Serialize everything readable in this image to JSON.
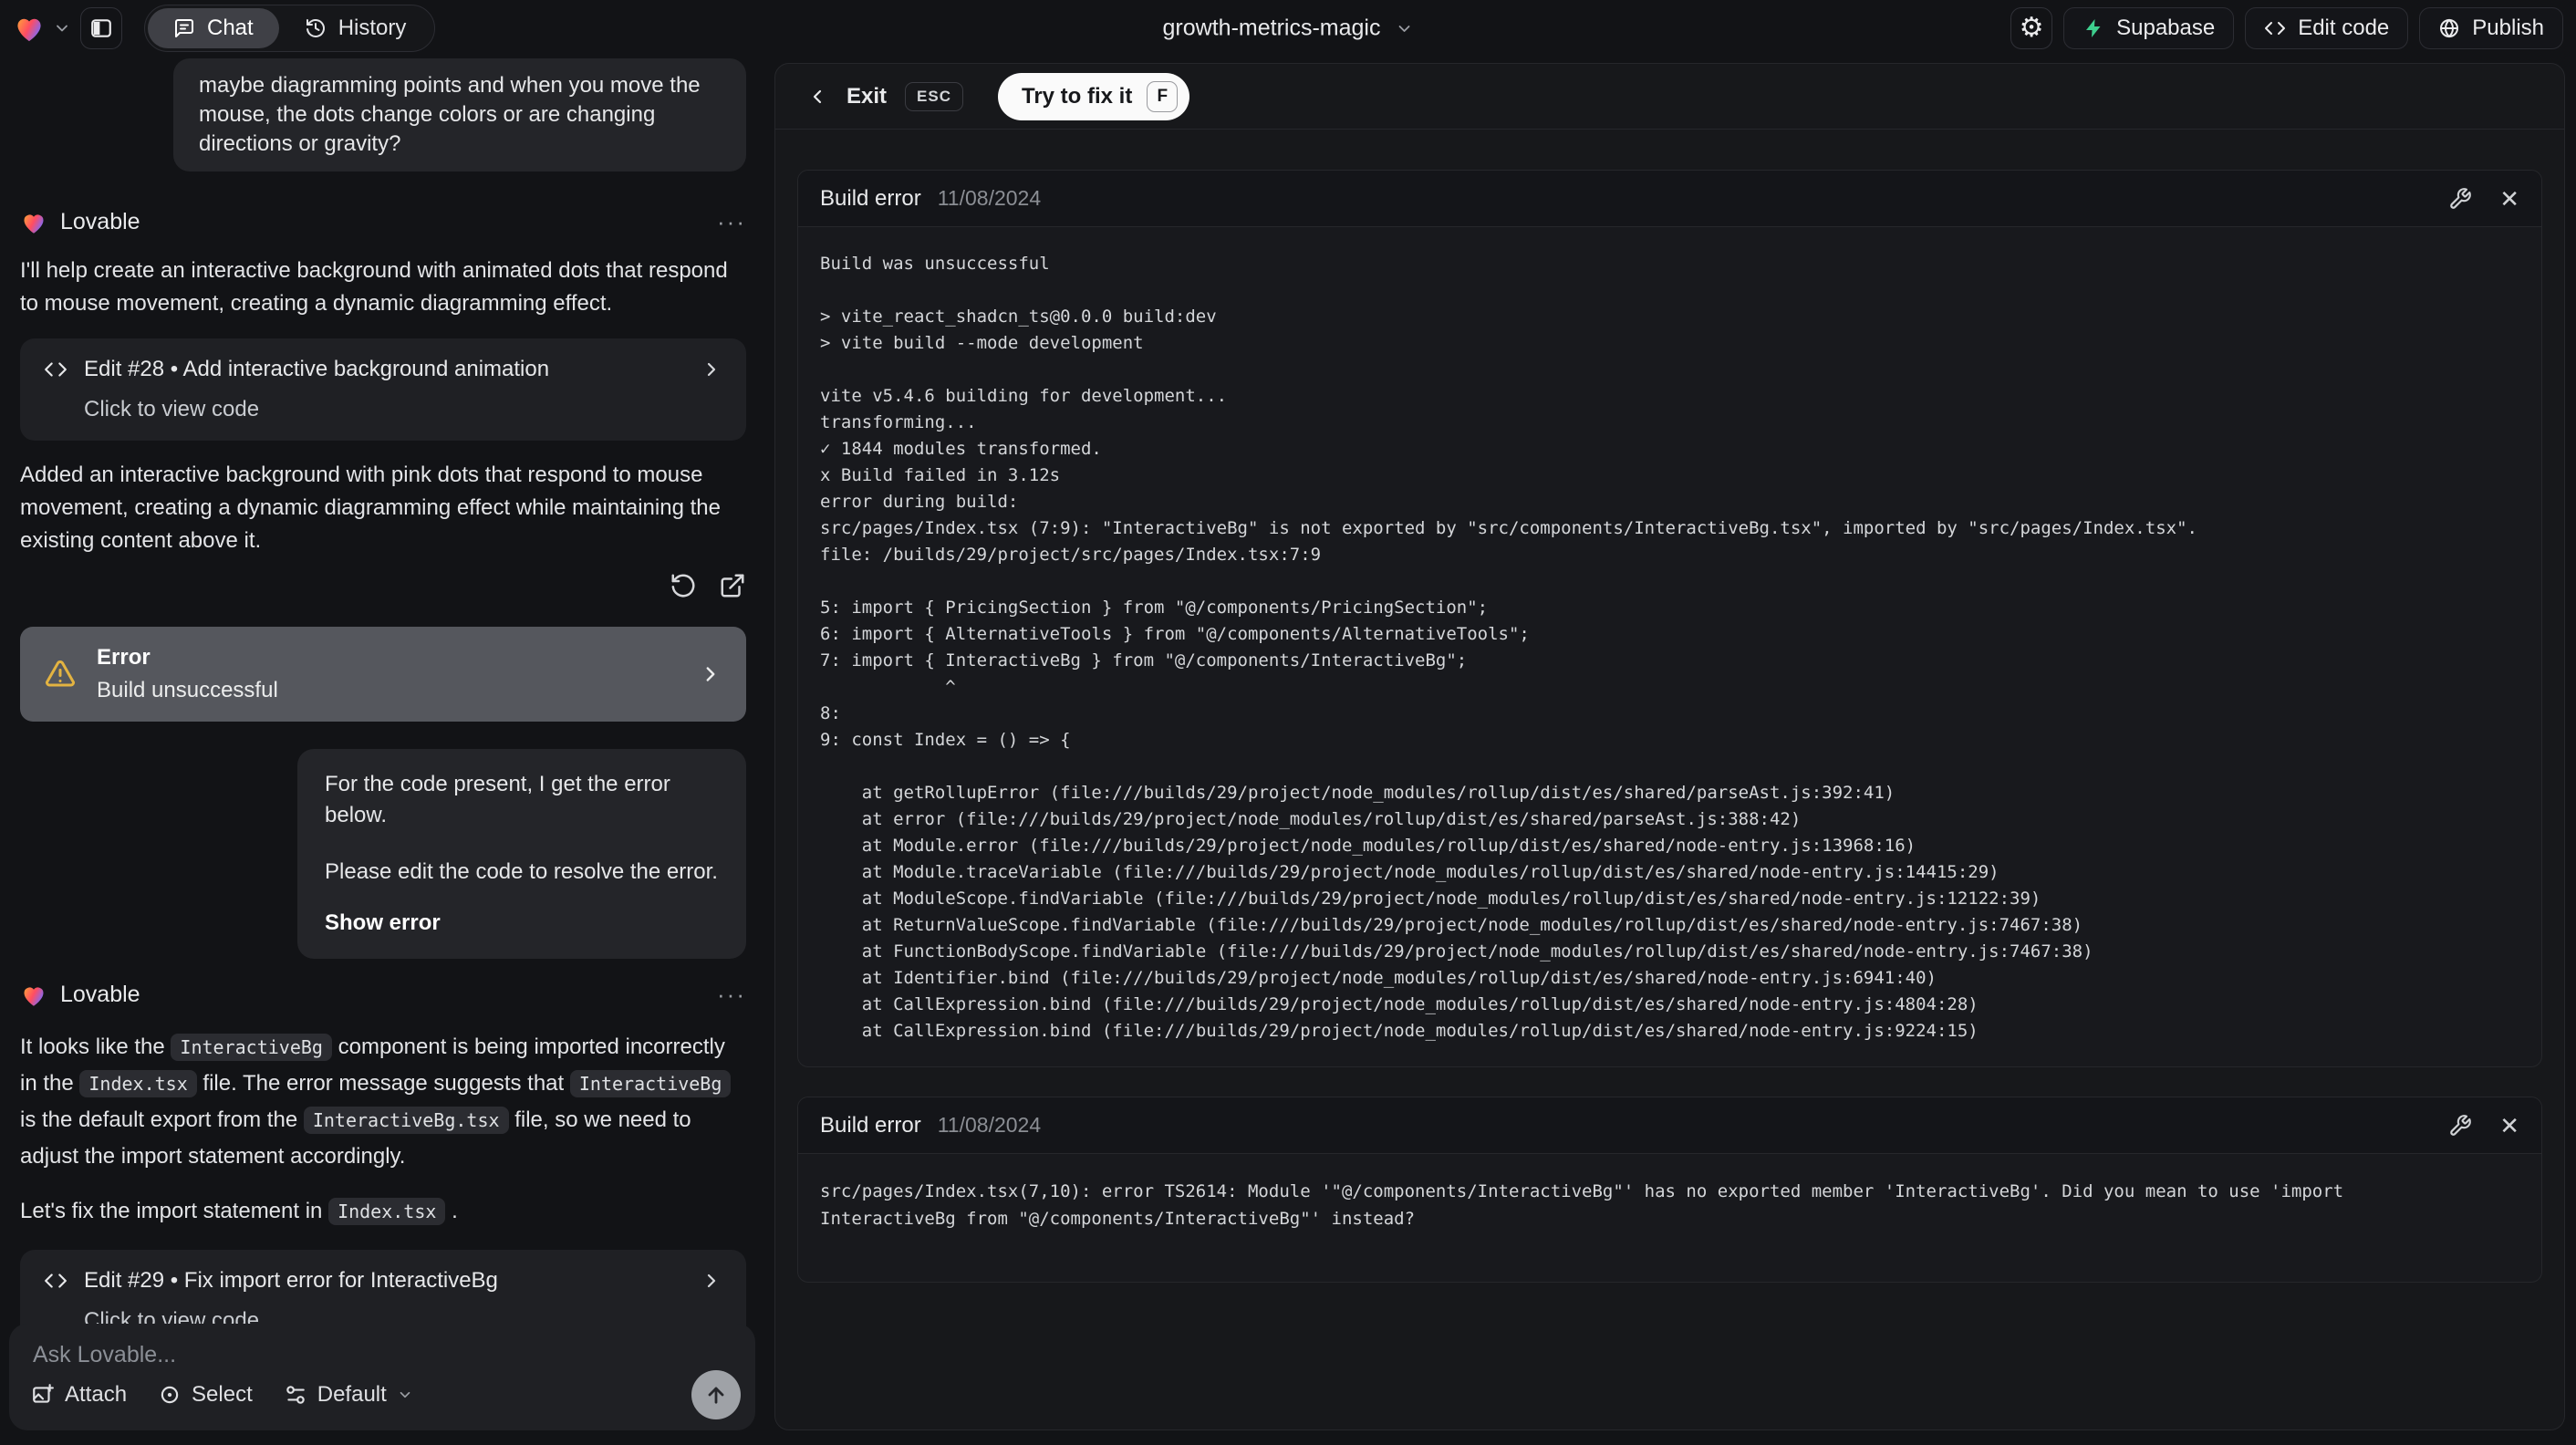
{
  "icons": {
    "gear": "⚙",
    "close": "✕",
    "ellipsis": "···"
  },
  "colors": {
    "accent_green": "#3ecf8e",
    "warning_yellow": "#e3b341",
    "fix_button_bg": "#fafafa"
  },
  "topbar": {
    "project_name": "growth-metrics-magic",
    "tab_chat": "Chat",
    "tab_history": "History",
    "supabase_label": "Supabase",
    "edit_code_label": "Edit code",
    "publish_label": "Publish"
  },
  "chat": {
    "assistant_name": "Lovable",
    "user_message_1": "maybe diagramming points and when you move the mouse, the dots change colors or are changing directions or gravity?",
    "lovable1": {
      "intro": "I'll help create an interactive background with animated dots that respond to mouse movement, creating a dynamic diagramming effect.",
      "edit_title": "Edit #28 • Add interactive background animation",
      "edit_subtitle": "Click to view code",
      "summary": "Added an interactive background with pink dots that respond to mouse movement, creating a dynamic diagramming effect while maintaining the existing content above it.",
      "error_title": "Error",
      "error_subtitle": "Build unsuccessful"
    },
    "user_message_2": {
      "line1": "For the code present, I get the error below.",
      "line2": "Please edit the code to resolve the error.",
      "action": "Show error"
    },
    "lovable2": {
      "seg1": "It looks like the ",
      "code1": "InteractiveBg",
      "seg2": " component is being imported incorrectly in the ",
      "code2": "Index.tsx",
      "seg3": " file. The error message suggests that ",
      "code3": "InteractiveBg",
      "seg4": " is the default export from the ",
      "code4": "InteractiveBg.tsx",
      "seg5": " file, so we need to adjust the import statement accordingly.",
      "fix_seg1": "Let's fix the import statement in ",
      "fix_code": "Index.tsx",
      "fix_seg2": " .",
      "edit_title": "Edit #29 • Fix import error for InteractiveBg",
      "edit_subtitle": "Click to view code"
    },
    "composer": {
      "placeholder": "Ask Lovable...",
      "attach": "Attach",
      "select": "Select",
      "mode": "Default"
    }
  },
  "panel": {
    "exit_label": "Exit",
    "esc_key": "ESC",
    "fix_button": "Try to fix it",
    "fix_key": "F",
    "card1": {
      "title": "Build error",
      "date": "11/08/2024",
      "log": "Build was unsuccessful\n\n> vite_react_shadcn_ts@0.0.0 build:dev\n> vite build --mode development\n\nvite v5.4.6 building for development...\ntransforming...\n✓ 1844 modules transformed.\nx Build failed in 3.12s\nerror during build:\nsrc/pages/Index.tsx (7:9): \"InteractiveBg\" is not exported by \"src/components/InteractiveBg.tsx\", imported by \"src/pages/Index.tsx\".\nfile: /builds/29/project/src/pages/Index.tsx:7:9\n\n5: import { PricingSection } from \"@/components/PricingSection\";\n6: import { AlternativeTools } from \"@/components/AlternativeTools\";\n7: import { InteractiveBg } from \"@/components/InteractiveBg\";\n            ^\n8:\n9: const Index = () => {\n\n    at getRollupError (file:///builds/29/project/node_modules/rollup/dist/es/shared/parseAst.js:392:41)\n    at error (file:///builds/29/project/node_modules/rollup/dist/es/shared/parseAst.js:388:42)\n    at Module.error (file:///builds/29/project/node_modules/rollup/dist/es/shared/node-entry.js:13968:16)\n    at Module.traceVariable (file:///builds/29/project/node_modules/rollup/dist/es/shared/node-entry.js:14415:29)\n    at ModuleScope.findVariable (file:///builds/29/project/node_modules/rollup/dist/es/shared/node-entry.js:12122:39)\n    at ReturnValueScope.findVariable (file:///builds/29/project/node_modules/rollup/dist/es/shared/node-entry.js:7467:38)\n    at FunctionBodyScope.findVariable (file:///builds/29/project/node_modules/rollup/dist/es/shared/node-entry.js:7467:38)\n    at Identifier.bind (file:///builds/29/project/node_modules/rollup/dist/es/shared/node-entry.js:6941:40)\n    at CallExpression.bind (file:///builds/29/project/node_modules/rollup/dist/es/shared/node-entry.js:4804:28)\n    at CallExpression.bind (file:///builds/29/project/node_modules/rollup/dist/es/shared/node-entry.js:9224:15)"
    },
    "card2": {
      "title": "Build error",
      "date": "11/08/2024",
      "log": "src/pages/Index.tsx(7,10): error TS2614: Module '\"@/components/InteractiveBg\"' has no exported member 'InteractiveBg'. Did you mean to use 'import\nInteractiveBg from \"@/components/InteractiveBg\"' instead?"
    }
  }
}
